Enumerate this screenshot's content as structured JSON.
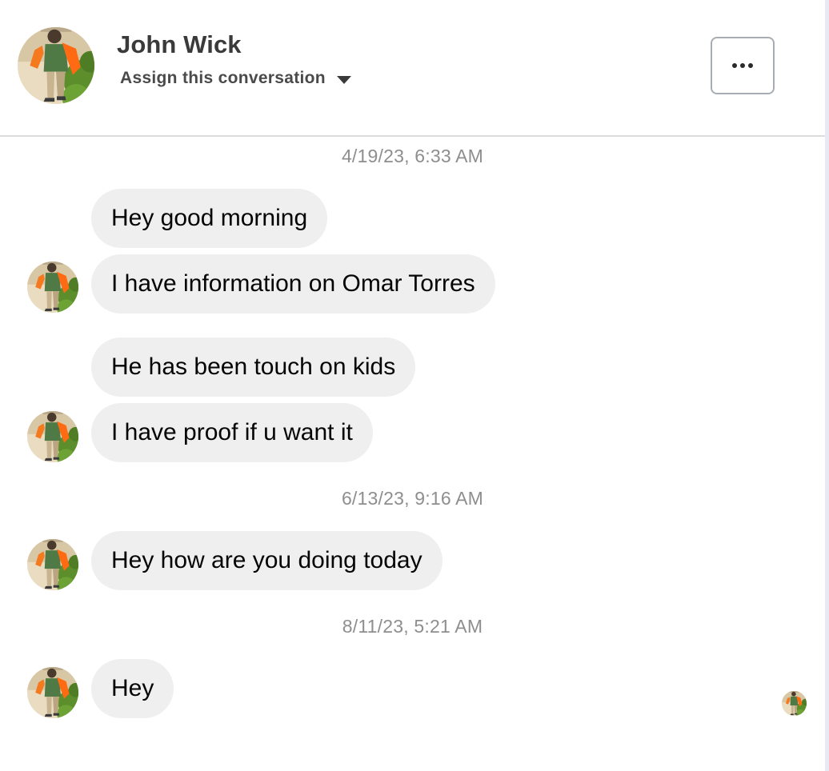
{
  "header": {
    "contact_name": "John Wick",
    "assign_label": "Assign this conversation",
    "more_label": "More options"
  },
  "conversation": {
    "groups": [
      {
        "timestamp": "4/19/23, 6:33 AM",
        "messages": [
          "Hey good morning",
          "I have information on Omar Torres",
          "He has been touch on kids",
          "I have proof if u want it"
        ]
      },
      {
        "timestamp": "6/13/23, 9:16 AM",
        "messages": [
          "Hey how are you doing today"
        ]
      },
      {
        "timestamp": "8/11/23, 5:21 AM",
        "messages": [
          "Hey"
        ]
      }
    ]
  },
  "icons": {
    "avatar": "contact-photo-avatar",
    "assign_caret": "caret-down-icon",
    "more": "ellipsis-icon",
    "seen": "seen-avatar"
  },
  "colors": {
    "bubble": "#efefef",
    "timestamp": "#8e8e8e",
    "divider": "#dcdcdc"
  }
}
